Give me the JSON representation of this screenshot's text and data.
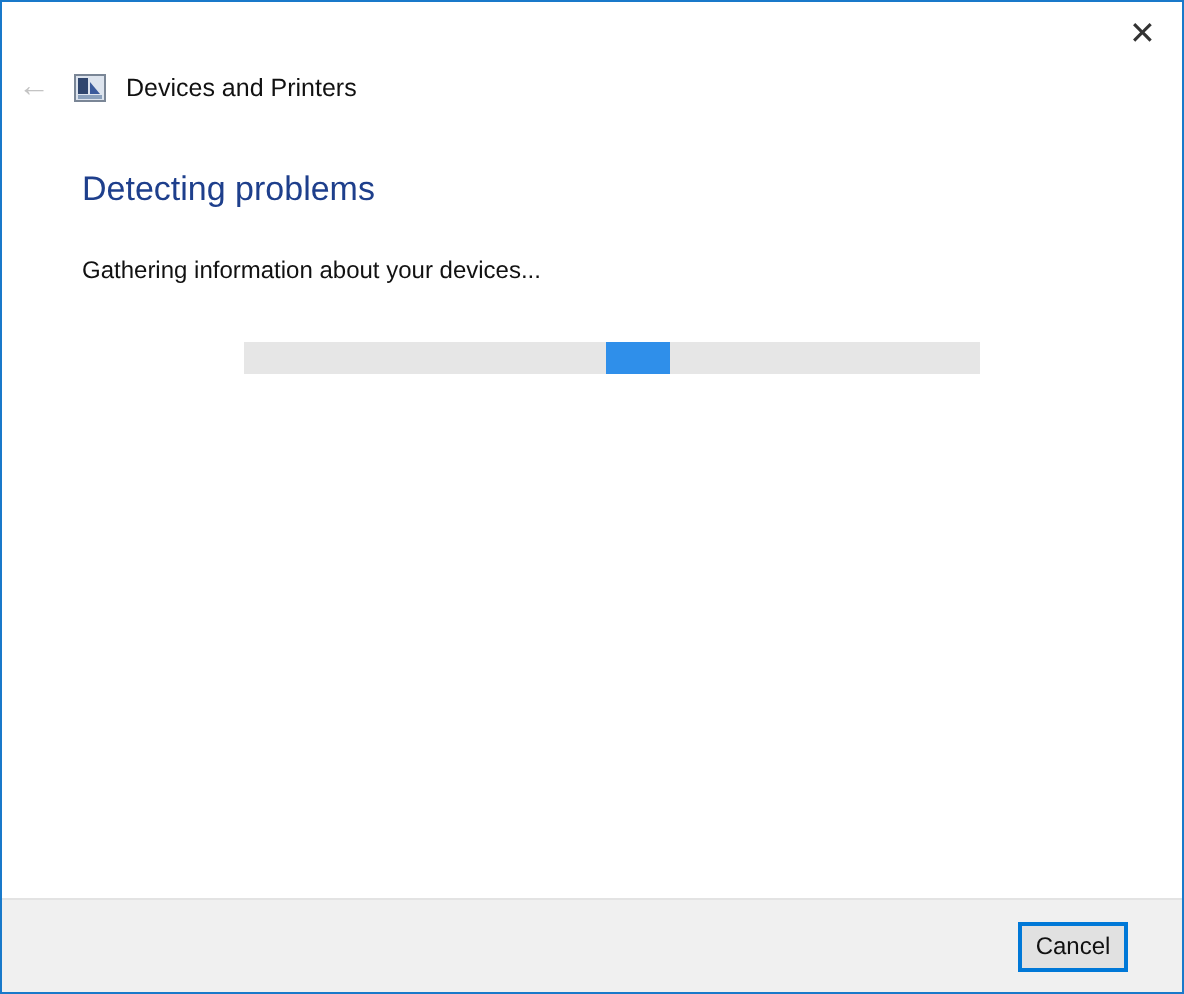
{
  "window": {
    "close_button": {
      "glyph": "✕"
    }
  },
  "nav": {
    "back_button": {
      "glyph": "←",
      "disabled": true
    },
    "title": "Devices and Printers"
  },
  "heading": "Detecting problems",
  "status_text": "Gathering information about your devices...",
  "progress": {
    "indeterminate": true
  },
  "buttons": [
    {
      "label": "Cancel",
      "default": true
    }
  ]
}
